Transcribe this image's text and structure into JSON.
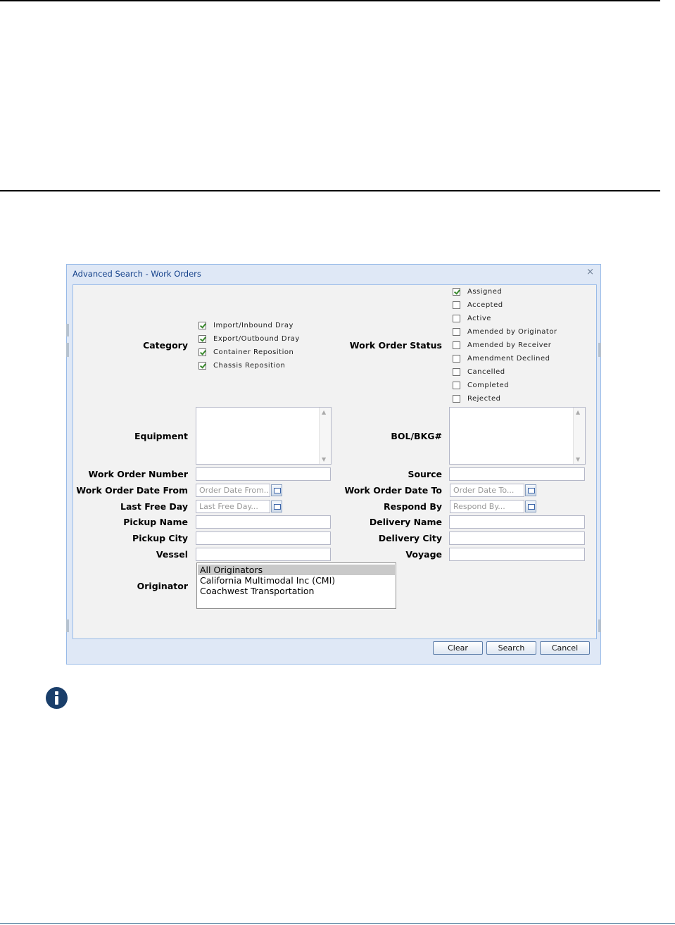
{
  "dialog": {
    "title": "Advanced Search - Work Orders",
    "close_glyph": "×"
  },
  "labels": {
    "category": "Category",
    "work_order_status": "Work Order Status",
    "equipment": "Equipment",
    "bol_bkg": "BOL/BKG#",
    "work_order_number": "Work Order Number",
    "source": "Source",
    "work_order_date_from": "Work Order Date From",
    "work_order_date_to": "Work Order Date To",
    "last_free_day": "Last Free Day",
    "respond_by": "Respond By",
    "pickup_name": "Pickup Name",
    "delivery_name": "Delivery Name",
    "pickup_city": "Pickup City",
    "delivery_city": "Delivery City",
    "vessel": "Vessel",
    "voyage": "Voyage",
    "originator": "Originator"
  },
  "category": [
    {
      "label": "Import/Inbound Dray",
      "checked": true
    },
    {
      "label": "Export/Outbound Dray",
      "checked": true
    },
    {
      "label": "Container Reposition",
      "checked": true
    },
    {
      "label": "Chassis Reposition",
      "checked": true
    }
  ],
  "status": [
    {
      "label": "Assigned",
      "checked": true
    },
    {
      "label": "Accepted",
      "checked": false
    },
    {
      "label": "Active",
      "checked": false
    },
    {
      "label": "Amended by Originator",
      "checked": false
    },
    {
      "label": "Amended by Receiver",
      "checked": false
    },
    {
      "label": "Amendment Declined",
      "checked": false
    },
    {
      "label": "Cancelled",
      "checked": false
    },
    {
      "label": "Completed",
      "checked": false
    },
    {
      "label": "Rejected",
      "checked": false
    }
  ],
  "placeholders": {
    "date_from": "Order Date From...",
    "date_to": "Order Date To...",
    "last_free_day": "Last Free Day...",
    "respond_by": "Respond By..."
  },
  "originators": [
    "All Originators",
    "California Multimodal Inc (CMI)",
    "Coachwest Transportation"
  ],
  "selected_originator": "All Originators",
  "buttons": {
    "clear": "Clear",
    "search": "Search",
    "cancel": "Cancel"
  },
  "icons": [
    "checkbox-icon",
    "calendar-icon",
    "close-icon",
    "info-icon",
    "scroll-arrow-icon"
  ]
}
